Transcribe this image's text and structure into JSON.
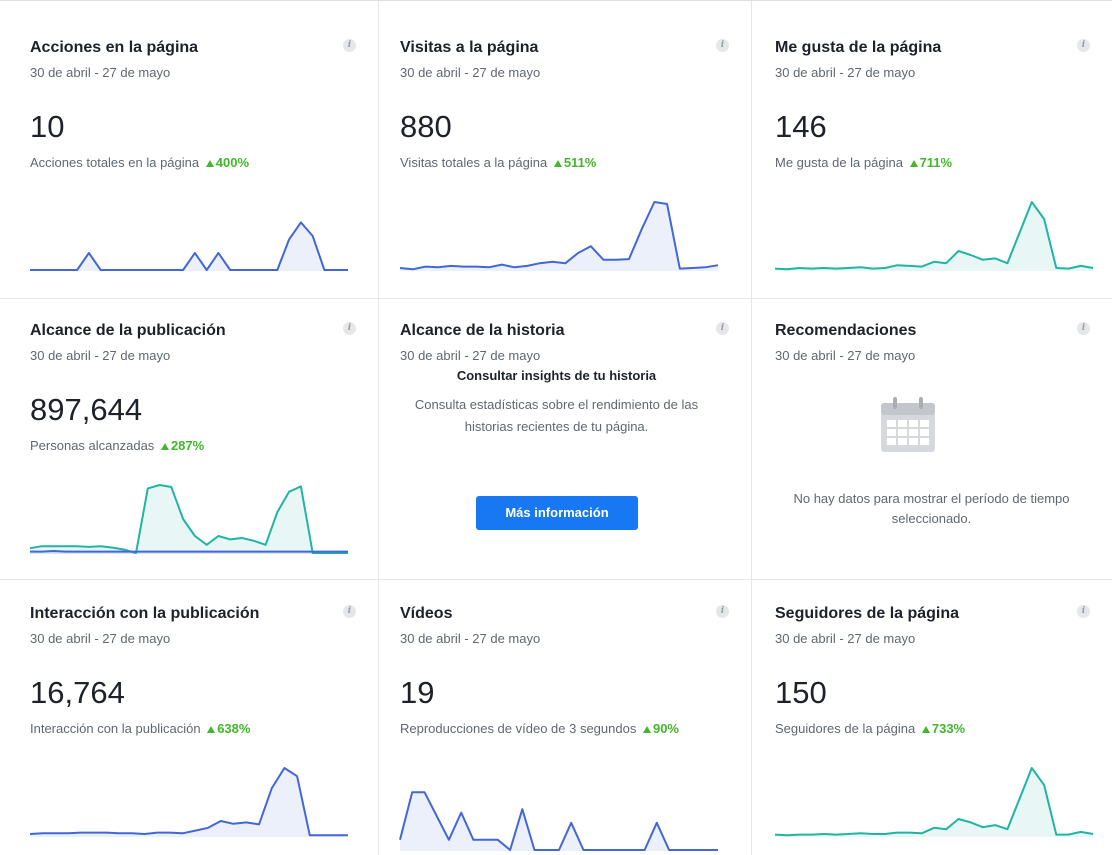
{
  "date_range": "30 de abril - 27 de mayo",
  "info_glyph": "i",
  "colors": {
    "blue": "#4267d6",
    "teal": "#20b5a3",
    "green": "#42b72a",
    "button": "#1877f2"
  },
  "cards": [
    {
      "title": "Acciones en la página",
      "value": "10",
      "subtitle": "Acciones totales en la página",
      "delta": "400%",
      "chart_data": {
        "type": "area",
        "series": [
          {
            "color": "#4267d6",
            "values": [
              0,
              0,
              0,
              0,
              0,
              0.25,
              0,
              0,
              0,
              0,
              0,
              0,
              0,
              0,
              0.25,
              0,
              0.25,
              0,
              0,
              0,
              0,
              0,
              0.45,
              0.7,
              0.5,
              0,
              0,
              0
            ]
          }
        ],
        "ylim": [
          0,
          1
        ]
      }
    },
    {
      "title": "Visitas a la página",
      "value": "880",
      "subtitle": "Visitas totales a la página",
      "delta": "511%",
      "chart_data": {
        "type": "area",
        "series": [
          {
            "color": "#4267d6",
            "values": [
              0.03,
              0.01,
              0.05,
              0.04,
              0.06,
              0.05,
              0.05,
              0.04,
              0.08,
              0.04,
              0.06,
              0.1,
              0.12,
              0.1,
              0.25,
              0.35,
              0.15,
              0.15,
              0.16,
              0.6,
              1.0,
              0.97,
              0.02,
              0.03,
              0.04,
              0.07
            ]
          }
        ],
        "ylim": [
          0,
          1
        ]
      }
    },
    {
      "title": "Me gusta de la página",
      "value": "146",
      "subtitle": "Me gusta de la página",
      "delta": "711%",
      "chart_data": {
        "type": "area",
        "series": [
          {
            "color": "#20b5a3",
            "values": [
              0.02,
              0.01,
              0.03,
              0.02,
              0.03,
              0.02,
              0.03,
              0.04,
              0.02,
              0.03,
              0.07,
              0.06,
              0.05,
              0.12,
              0.1,
              0.28,
              0.22,
              0.15,
              0.17,
              0.1,
              0.55,
              1.0,
              0.75,
              0.03,
              0.02,
              0.06,
              0.03
            ]
          }
        ],
        "ylim": [
          0,
          1
        ]
      }
    },
    {
      "title": "Alcance de la publicación",
      "value": "897,644",
      "subtitle": "Personas alcanzadas",
      "delta": "287%",
      "chart_data": {
        "type": "area",
        "series": [
          {
            "color": "#20b5a3",
            "values": [
              0.07,
              0.1,
              0.1,
              0.1,
              0.1,
              0.09,
              0.1,
              0.08,
              0.05,
              0.0,
              0.95,
              1.0,
              0.97,
              0.5,
              0.25,
              0.12,
              0.25,
              0.2,
              0.22,
              0.18,
              0.12,
              0.6,
              0.9,
              0.98,
              0.0,
              0.0,
              0.0,
              0.0
            ]
          },
          {
            "color": "#4267d6",
            "values": [
              0.02,
              0.02,
              0.03,
              0.02,
              0.02,
              0.02,
              0.02,
              0.02,
              0.02,
              0.02,
              0.02,
              0.02,
              0.02,
              0.02,
              0.02,
              0.02,
              0.02,
              0.02,
              0.02,
              0.02,
              0.02,
              0.02,
              0.02,
              0.02,
              0.02,
              0.02,
              0.02,
              0.02
            ]
          }
        ],
        "ylim": [
          0,
          1
        ]
      }
    },
    {
      "title": "Alcance de la historia",
      "story_heading": "Consultar insights de tu historia",
      "story_text": "Consulta estadísticas sobre el rendimiento de las historias recientes de tu página.",
      "button_label": "Más información"
    },
    {
      "title": "Recomendaciones",
      "empty_icon": "calendar-icon",
      "empty_message": "No hay datos para mostrar el período de tiempo seleccionado."
    },
    {
      "title": "Interacción con la publicación",
      "value": "16,764",
      "subtitle": "Interacción con la publicación",
      "delta": "638%",
      "chart_data": {
        "type": "area",
        "series": [
          {
            "color": "#4267d6",
            "values": [
              0.03,
              0.04,
              0.04,
              0.04,
              0.05,
              0.05,
              0.05,
              0.04,
              0.04,
              0.03,
              0.05,
              0.05,
              0.04,
              0.08,
              0.12,
              0.22,
              0.18,
              0.2,
              0.17,
              0.7,
              1.0,
              0.88,
              0.01,
              0.01,
              0.01,
              0.01
            ]
          }
        ],
        "ylim": [
          0,
          1
        ]
      }
    },
    {
      "title": "Vídeos",
      "value": "19",
      "subtitle": "Reproducciones de vídeo de 3 segundos",
      "delta": "90%",
      "chart_data": {
        "type": "area",
        "series": [
          {
            "color": "#4267d6",
            "values": [
              0.15,
              0.85,
              0.85,
              0.5,
              0.15,
              0.55,
              0.15,
              0.15,
              0.15,
              0.0,
              0.6,
              0.0,
              0.0,
              0.0,
              0.4,
              0.0,
              0.0,
              0.0,
              0.0,
              0.0,
              0.0,
              0.4,
              0.0,
              0.0,
              0.0,
              0.0,
              0.0
            ]
          }
        ],
        "ylim": [
          0,
          1
        ]
      }
    },
    {
      "title": "Seguidores de la página",
      "value": "150",
      "subtitle": "Seguidores de la página",
      "delta": "733%",
      "chart_data": {
        "type": "area",
        "series": [
          {
            "color": "#20b5a3",
            "values": [
              0.02,
              0.01,
              0.02,
              0.02,
              0.03,
              0.02,
              0.03,
              0.04,
              0.03,
              0.03,
              0.05,
              0.05,
              0.04,
              0.12,
              0.1,
              0.25,
              0.2,
              0.13,
              0.16,
              0.1,
              0.55,
              1.0,
              0.75,
              0.02,
              0.02,
              0.06,
              0.03
            ]
          }
        ],
        "ylim": [
          0,
          1
        ]
      }
    }
  ]
}
